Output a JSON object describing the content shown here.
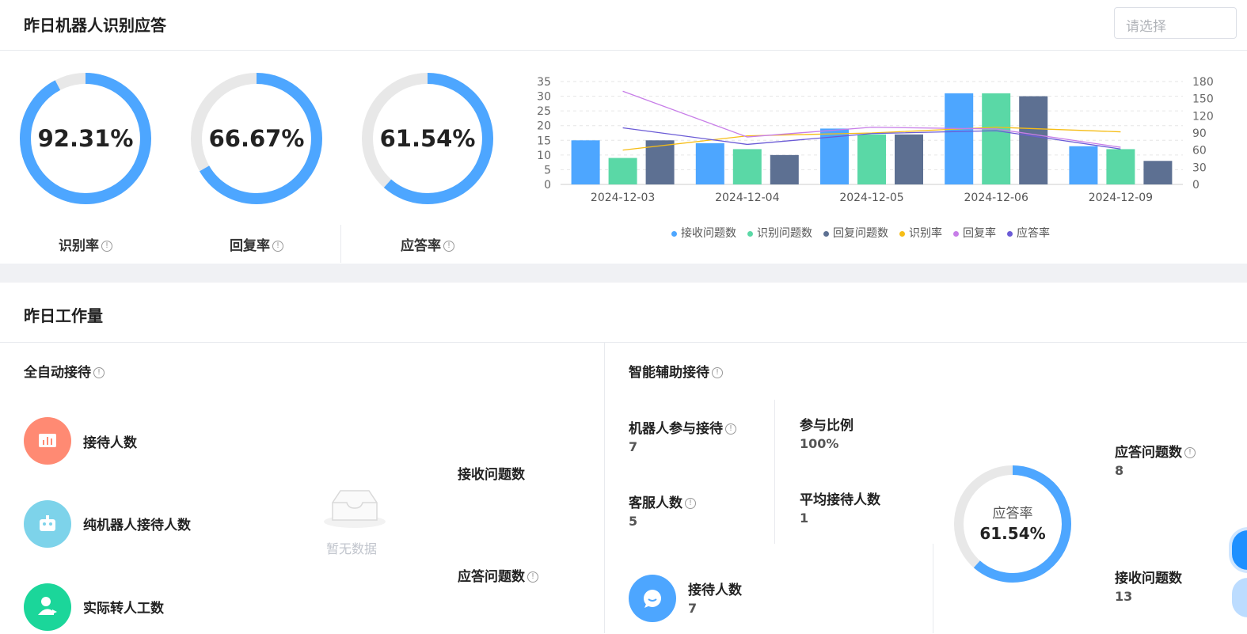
{
  "section1": {
    "title": "昨日机器人识别应答",
    "select_placeholder": "请选择",
    "rings": [
      {
        "value_text": "92.31%",
        "fraction": 0.9231,
        "label": "识别率"
      },
      {
        "value_text": "66.67%",
        "fraction": 0.6667,
        "label": "回复率"
      },
      {
        "value_text": "61.54%",
        "fraction": 0.6154,
        "label": "应答率"
      }
    ]
  },
  "chart_data": {
    "type": "bar",
    "categories": [
      "2024-12-03",
      "2024-12-04",
      "2024-12-05",
      "2024-12-06",
      "2024-12-09"
    ],
    "y_left": {
      "ylim": [
        0,
        35
      ],
      "ticks": [
        "0",
        "5",
        "10",
        "15",
        "20",
        "25",
        "30",
        "35"
      ]
    },
    "y_right": {
      "ylim": [
        0,
        180
      ],
      "ticks": [
        "0",
        "30",
        "60",
        "90",
        "120",
        "150",
        "180"
      ]
    },
    "grid": true,
    "legend_position": "bottom",
    "series": [
      {
        "name": "接收问题数",
        "kind": "bar",
        "axis": "left",
        "color": "#4da6ff",
        "values": [
          15,
          14,
          19,
          31,
          13
        ]
      },
      {
        "name": "识别问题数",
        "kind": "bar",
        "axis": "left",
        "color": "#5ad8a6",
        "values": [
          9,
          12,
          17,
          31,
          12
        ]
      },
      {
        "name": "回复问题数",
        "kind": "bar",
        "axis": "left",
        "color": "#5d7092",
        "values": [
          15,
          10,
          17,
          30,
          8
        ]
      },
      {
        "name": "识别率",
        "kind": "line",
        "axis": "right",
        "color": "#f6bd16",
        "values": [
          60,
          85,
          90,
          100,
          92
        ]
      },
      {
        "name": "回复率",
        "kind": "line",
        "axis": "right",
        "color": "#c77de8",
        "values": [
          163,
          83,
          100,
          97,
          65
        ]
      },
      {
        "name": "应答率",
        "kind": "line",
        "axis": "right",
        "color": "#6b5bd6",
        "values": [
          99,
          70,
          89,
          94,
          62
        ]
      }
    ]
  },
  "section2": {
    "title": "昨日工作量",
    "auto": {
      "title": "全自动接待",
      "items": [
        "接待人数",
        "纯机器人接待人数",
        "实际转人工数"
      ],
      "empty_text": "暂无数据",
      "right_labels": [
        "接收问题数",
        "应答问题数"
      ]
    },
    "assist": {
      "title": "智能辅助接待",
      "robot_join_label": "机器人参与接待",
      "robot_join_value": "7",
      "ratio_label": "参与比例",
      "ratio_value": "100%",
      "agent_count_label": "客服人数",
      "agent_count_value": "5",
      "avg_label": "平均接待人数",
      "avg_value": "1",
      "reception_label": "接待人数",
      "reception_value": "7",
      "ring_label": "应答率",
      "ring_value": "61.54%",
      "ring_fraction": 0.6154,
      "answered_label": "应答问题数",
      "answered_value": "8",
      "received_label": "接收问题数",
      "received_value": "13"
    }
  },
  "colors": {
    "ring": "#4da6ff",
    "ring_track": "#e8e8e8",
    "icon_red": "#ff8a73",
    "icon_cyan": "#7dd3ea",
    "icon_green": "#1bd69a",
    "icon_blue": "#4da6ff"
  }
}
